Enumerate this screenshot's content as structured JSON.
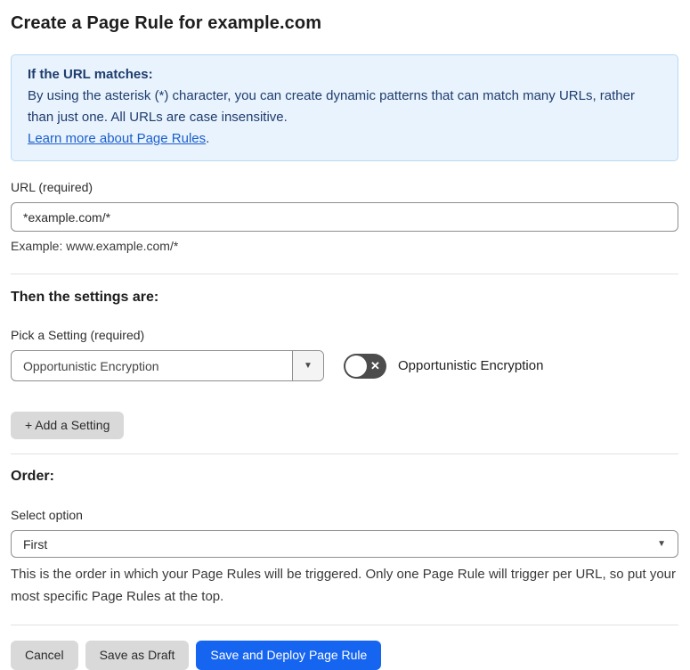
{
  "page": {
    "title": "Create a Page Rule for example.com"
  },
  "info_box": {
    "heading": "If the URL matches:",
    "body": "By using the asterisk (*) character, you can create dynamic patterns that can match many URLs, rather than just one. All URLs are case insensitive.",
    "link_label": "Learn more about Page Rules",
    "link_suffix": "."
  },
  "url_field": {
    "label": "URL (required)",
    "value": "*example.com/*",
    "helper": "Example: www.example.com/*"
  },
  "settings_section": {
    "heading": "Then the settings are:",
    "picker_label": "Pick a Setting (required)",
    "picker_value": "Opportunistic Encryption",
    "toggle_label": "Opportunistic Encryption",
    "toggle_state": "off",
    "toggle_off_glyph": "✕",
    "add_setting_label": "+ Add a Setting"
  },
  "order_section": {
    "heading": "Order:",
    "select_label": "Select option",
    "select_value": "First",
    "helper": "This is the order in which your Page Rules will be triggered. Only one Page Rule will trigger per URL, so put your most specific Page Rules at the top."
  },
  "actions": {
    "cancel_label": "Cancel",
    "save_draft_label": "Save as Draft",
    "save_deploy_label": "Save and Deploy Page Rule"
  },
  "icons": {
    "caret_down": "▼"
  },
  "colors": {
    "primary_blue": "#1665f0",
    "info_bg": "#e9f3fd",
    "info_border": "#b7d8f4",
    "info_text": "#1e3c6e",
    "link_blue": "#1b5fcc",
    "toggle_off_bg": "#4c4c4c",
    "button_gray": "#d9d9d9",
    "border_gray": "#8f8f8f"
  }
}
